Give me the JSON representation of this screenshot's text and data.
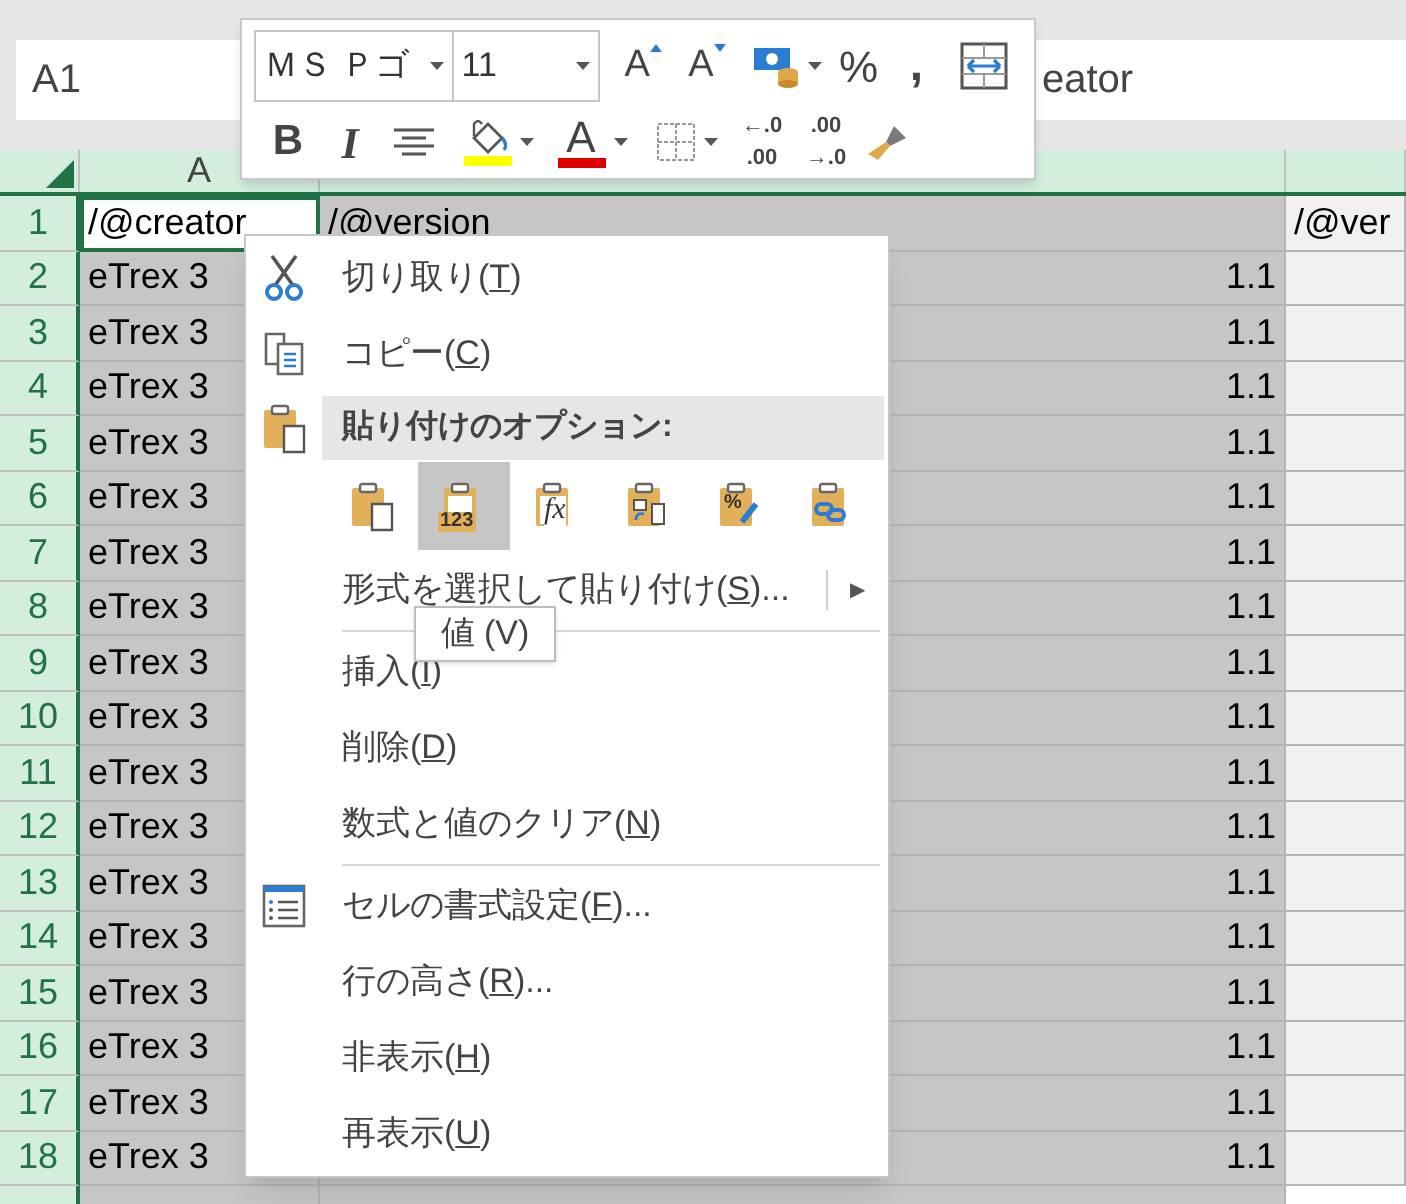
{
  "name_box": {
    "value": "A1"
  },
  "formula_bar": {
    "value": "eator"
  },
  "mini_toolbar": {
    "font_name": "ＭＳ Ｐゴ",
    "font_size": "11",
    "row1": [
      {
        "kind": "grow_font",
        "text": "A"
      },
      {
        "kind": "shrink_font",
        "text": "A"
      },
      {
        "kind": "currency"
      },
      {
        "kind": "percent",
        "text": "%"
      },
      {
        "kind": "comma",
        "text": ","
      },
      {
        "kind": "wrap"
      }
    ],
    "row2": [
      {
        "kind": "bold",
        "text": "B"
      },
      {
        "kind": "italic",
        "text": "I"
      },
      {
        "kind": "center"
      },
      {
        "kind": "fill_color",
        "color": "#ffff00"
      },
      {
        "kind": "font_color",
        "text": "A",
        "color": "#e00000"
      },
      {
        "kind": "borders"
      },
      {
        "kind": "decrease_decimal",
        "lines": [
          "←.0",
          ".00"
        ]
      },
      {
        "kind": "increase_decimal",
        "lines": [
          ".00",
          "→.0"
        ]
      },
      {
        "kind": "format_painter"
      }
    ]
  },
  "column_headers": [
    "A"
  ],
  "rows": [
    {
      "number": "1",
      "selected": true,
      "cells": [
        {
          "text": "/@creator",
          "active": true
        },
        {
          "text": "/@version",
          "selected": true
        },
        {
          "text": "/@ver",
          "selected": false
        }
      ]
    },
    {
      "number": "2",
      "selected": true,
      "cells": [
        {
          "text": "eTrex 3",
          "selected": true
        },
        {
          "text": "1.1",
          "kind": "number",
          "selected": true
        },
        {
          "selected": false
        }
      ]
    },
    {
      "number": "3",
      "selected": true,
      "cells": [
        {
          "text": "eTrex 3",
          "selected": true
        },
        {
          "text": "1.1",
          "kind": "number",
          "selected": true
        },
        {
          "selected": false
        }
      ]
    },
    {
      "number": "4",
      "selected": true,
      "cells": [
        {
          "text": "eTrex 3",
          "selected": true
        },
        {
          "text": "1.1",
          "kind": "number",
          "selected": true
        },
        {
          "selected": false
        }
      ]
    },
    {
      "number": "5",
      "selected": true,
      "cells": [
        {
          "text": "eTrex 3",
          "selected": true
        },
        {
          "text": "1.1",
          "kind": "number",
          "selected": true
        },
        {
          "selected": false
        }
      ]
    },
    {
      "number": "6",
      "selected": true,
      "cells": [
        {
          "text": "eTrex 3",
          "selected": true
        },
        {
          "text": "1.1",
          "kind": "number",
          "selected": true
        },
        {
          "selected": false
        }
      ]
    },
    {
      "number": "7",
      "selected": true,
      "cells": [
        {
          "text": "eTrex 3",
          "selected": true
        },
        {
          "text": "1.1",
          "kind": "number",
          "selected": true
        },
        {
          "selected": false
        }
      ]
    },
    {
      "number": "8",
      "selected": true,
      "cells": [
        {
          "text": "eTrex 3",
          "selected": true
        },
        {
          "text": "1.1",
          "kind": "number",
          "selected": true
        },
        {
          "selected": false
        }
      ]
    },
    {
      "number": "9",
      "selected": true,
      "cells": [
        {
          "text": "eTrex 3",
          "selected": true
        },
        {
          "text": "1.1",
          "kind": "number",
          "selected": true
        },
        {
          "selected": false
        }
      ]
    },
    {
      "number": "10",
      "selected": true,
      "cells": [
        {
          "text": "eTrex 3",
          "selected": true
        },
        {
          "text": "1.1",
          "kind": "number",
          "selected": true
        },
        {
          "selected": false
        }
      ]
    },
    {
      "number": "11",
      "selected": true,
      "cells": [
        {
          "text": "eTrex 3",
          "selected": true
        },
        {
          "text": "1.1",
          "kind": "number",
          "selected": true
        },
        {
          "selected": false
        }
      ]
    },
    {
      "number": "12",
      "selected": true,
      "cells": [
        {
          "text": "eTrex 3",
          "selected": true
        },
        {
          "text": "1.1",
          "kind": "number",
          "selected": true
        },
        {
          "selected": false
        }
      ]
    },
    {
      "number": "13",
      "selected": true,
      "cells": [
        {
          "text": "eTrex 3",
          "selected": true
        },
        {
          "text": "1.1",
          "kind": "number",
          "selected": true
        },
        {
          "selected": false
        }
      ]
    },
    {
      "number": "14",
      "selected": true,
      "cells": [
        {
          "text": "eTrex 3",
          "selected": true
        },
        {
          "text": "1.1",
          "kind": "number",
          "selected": true
        },
        {
          "selected": false
        }
      ]
    },
    {
      "number": "15",
      "selected": true,
      "cells": [
        {
          "text": "eTrex 3",
          "selected": true
        },
        {
          "text": "1.1",
          "kind": "number",
          "selected": true
        },
        {
          "selected": false
        }
      ]
    },
    {
      "number": "16",
      "selected": true,
      "cells": [
        {
          "text": "eTrex 3",
          "selected": true
        },
        {
          "text": "1.1",
          "kind": "number",
          "selected": true
        },
        {
          "selected": false
        }
      ]
    },
    {
      "number": "17",
      "selected": true,
      "cells": [
        {
          "text": "eTrex 3",
          "selected": true
        },
        {
          "text": "1.1",
          "kind": "number",
          "selected": true
        },
        {
          "selected": false
        }
      ]
    },
    {
      "number": "18",
      "selected": true,
      "cells": [
        {
          "text": "eTrex 3",
          "selected": true
        },
        {
          "text": "1.1",
          "kind": "number",
          "selected": true
        },
        {
          "selected": false
        }
      ]
    }
  ],
  "context_menu": [
    {
      "kind": "cut",
      "label": "切り取り(",
      "key": "T",
      "tail": ")"
    },
    {
      "kind": "copy",
      "label": "コピー(",
      "key": "C",
      "tail": ")"
    },
    {
      "kind": "paste_header",
      "label": "貼り付けのオプション:"
    },
    {
      "kind": "paste_options",
      "options": [
        {
          "kind": "paste",
          "selected": false
        },
        {
          "kind": "values",
          "caption": "123",
          "selected": true
        },
        {
          "kind": "formulas",
          "caption": "fx",
          "selected": false
        },
        {
          "kind": "transpose",
          "selected": false
        },
        {
          "kind": "formatting",
          "caption": "%",
          "selected": false
        },
        {
          "kind": "link",
          "selected": false
        }
      ]
    },
    {
      "kind": "submenu",
      "label": "形式を選択して貼り付け(",
      "key": "S",
      "tail": ")...",
      "arrow": "▶"
    },
    {
      "kind": "separator"
    },
    {
      "kind": "command",
      "label": "挿入(",
      "key": "I",
      "tail": ")"
    },
    {
      "kind": "command",
      "label": "削除(",
      "key": "D",
      "tail": ")"
    },
    {
      "kind": "command",
      "label": "数式と値のクリア(",
      "key": "N",
      "tail": ")"
    },
    {
      "kind": "separator"
    },
    {
      "kind": "format_cells",
      "label": "セルの書式設定(",
      "key": "F",
      "tail": ")..."
    },
    {
      "kind": "command",
      "label": "行の高さ(",
      "key": "R",
      "tail": ")..."
    },
    {
      "kind": "command",
      "label": "非表示(",
      "key": "H",
      "tail": ")"
    },
    {
      "kind": "command",
      "label": "再表示(",
      "key": "U",
      "tail": ")"
    }
  ],
  "tooltip": {
    "text": "値 (V)"
  }
}
